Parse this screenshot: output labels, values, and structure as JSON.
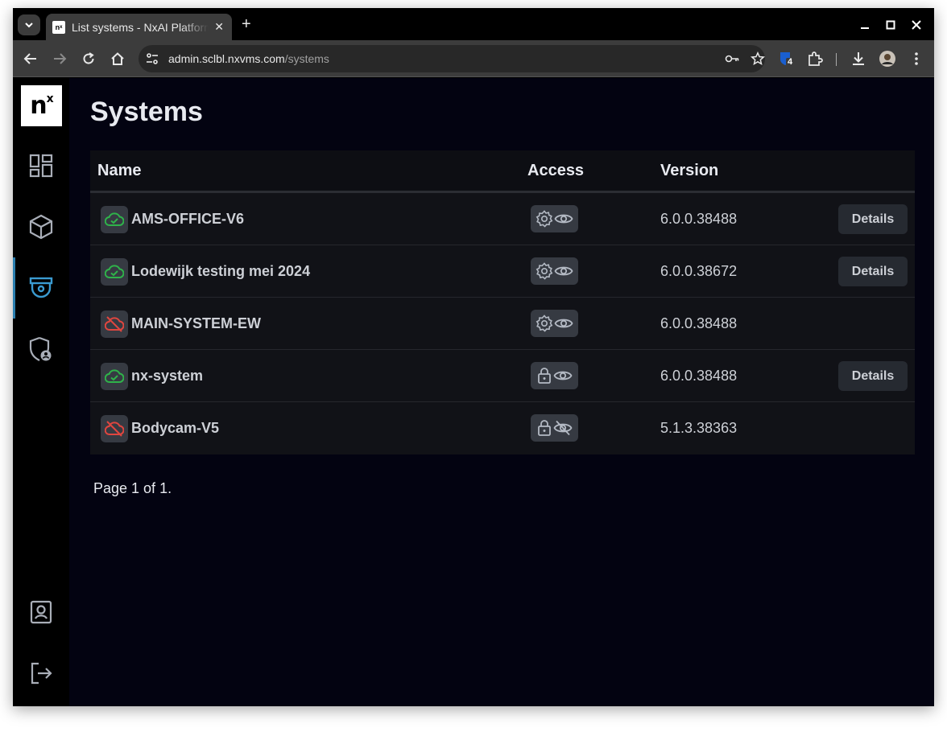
{
  "browser": {
    "tab_title": "List systems - NxAI Platform",
    "tab_favicon_text": "nˣ",
    "url_host": "admin.sclbl.nxvms.com",
    "url_path": "/systems",
    "extension_badge": "4"
  },
  "sidebar": {
    "logo_text": "n",
    "logo_sup": "x",
    "items": [
      {
        "icon": "dashboard-icon"
      },
      {
        "icon": "cube-icon"
      },
      {
        "icon": "camera-icon",
        "active": true
      },
      {
        "icon": "shield-user-icon"
      }
    ],
    "bottom_items": [
      {
        "icon": "profile-icon"
      },
      {
        "icon": "logout-icon"
      }
    ]
  },
  "page": {
    "title": "Systems",
    "columns": {
      "name": "Name",
      "access": "Access",
      "version": "Version"
    },
    "rows": [
      {
        "name": "AMS-OFFICE-V6",
        "online": true,
        "access": "admin",
        "visible": true,
        "version": "6.0.0.38488",
        "details": "Details"
      },
      {
        "name": "Lodewijk testing mei 2024",
        "online": true,
        "access": "admin",
        "visible": true,
        "version": "6.0.0.38672",
        "details": "Details"
      },
      {
        "name": "MAIN-SYSTEM-EW",
        "online": false,
        "access": "admin",
        "visible": true,
        "version": "6.0.0.38488",
        "details": ""
      },
      {
        "name": "nx-system",
        "online": true,
        "access": "locked",
        "visible": true,
        "version": "6.0.0.38488",
        "details": "Details"
      },
      {
        "name": "Bodycam-V5",
        "online": false,
        "access": "locked",
        "visible": false,
        "version": "5.1.3.38363",
        "details": ""
      }
    ],
    "pager": "Page 1 of 1."
  },
  "colors": {
    "online": "#2fb34a",
    "offline": "#e0463f",
    "active_nav": "#2b7fb0",
    "background": "#030311"
  }
}
